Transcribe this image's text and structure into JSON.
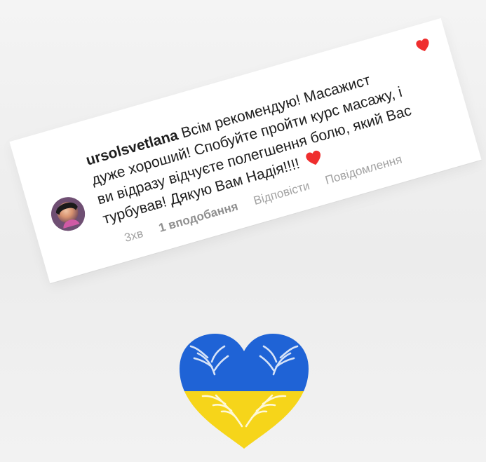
{
  "comment": {
    "ghost_text": "",
    "username": "ursolsvetlana",
    "text": "Всім рекомендую! Масажист дуже хороший! Спобуйте пройти курс масажу, і ви відразу відчуєте полегшення болю, який Вас турбував! Дякую Вам Надія!!!!",
    "emoji": "❤️",
    "time": "3хв",
    "likes": "1 вподобання",
    "reply": "Відповісти",
    "report": "Повідомлення"
  },
  "icons": {
    "avatar": "user-avatar",
    "like": "heart-icon",
    "decoration": "ukrainian-heart-icon"
  },
  "colors": {
    "heart_red": "#ef2e2e",
    "ukraine_blue": "#1f63d6",
    "ukraine_yellow": "#f6d51a",
    "muted_text": "#a2a2a2"
  }
}
